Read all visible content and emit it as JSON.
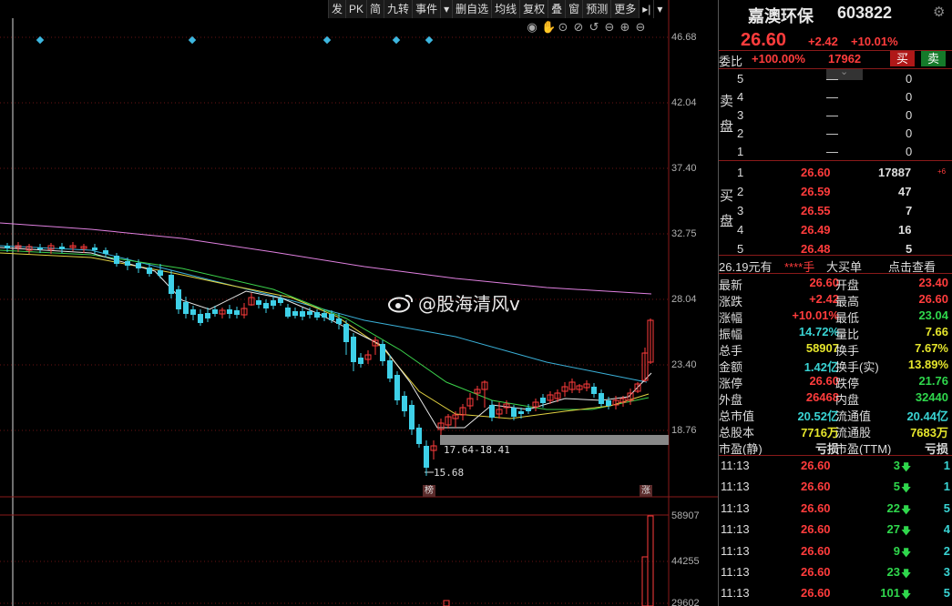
{
  "toolbar": {
    "items": [
      "发",
      "PK",
      "简",
      "九转",
      "事件",
      "▾",
      "删自选",
      "均线",
      "复权",
      "叠",
      "窗",
      "预测",
      "更多",
      "▸|",
      "▾"
    ]
  },
  "chart_tools": [
    "◉",
    "✋",
    "⊙",
    "⊘",
    "↺",
    "⊖",
    "⊕",
    "⊖"
  ],
  "price_axis": [
    "46.68",
    "42.04",
    "37.40",
    "32.75",
    "28.04",
    "23.40",
    "18.76"
  ],
  "volume_axis": [
    "58907",
    "44255",
    "29602"
  ],
  "markers": {
    "range_label": "17.64-18.41",
    "low_label": "15.68",
    "tag_bang": "榜",
    "tag_zhang": "涨"
  },
  "watermark": "@股海清风v",
  "stock": {
    "name": "嘉澳环保",
    "code": "603822",
    "price": "26.60",
    "change": "+2.42",
    "change_pct": "+10.01%"
  },
  "weibi": {
    "label": "委比",
    "value": "+100.00%",
    "diff": "17962",
    "sell_btn": "买",
    "buy_btn": "卖"
  },
  "sell_side": {
    "label": "卖盘",
    "rows": [
      {
        "level": "5",
        "price": "—",
        "volume": "0"
      },
      {
        "level": "4",
        "price": "—",
        "volume": "0"
      },
      {
        "level": "3",
        "price": "—",
        "volume": "0"
      },
      {
        "level": "2",
        "price": "—",
        "volume": "0"
      },
      {
        "level": "1",
        "price": "—",
        "volume": "0"
      }
    ]
  },
  "buy_side": {
    "label": "买盘",
    "rows": [
      {
        "level": "1",
        "price": "26.60",
        "volume": "17887",
        "extra": "+6"
      },
      {
        "level": "2",
        "price": "26.59",
        "volume": "47",
        "extra": ""
      },
      {
        "level": "3",
        "price": "26.55",
        "volume": "7",
        "extra": ""
      },
      {
        "level": "4",
        "price": "26.49",
        "volume": "16",
        "extra": ""
      },
      {
        "level": "5",
        "price": "26.48",
        "volume": "5",
        "extra": ""
      }
    ]
  },
  "big_order": {
    "amount": "26.19元有",
    "hand": "****手",
    "label": "大买单",
    "link": "点击查看"
  },
  "quote": [
    {
      "l1": "最新",
      "v1": "26.60",
      "l2": "开盘",
      "v2": "23.40"
    },
    {
      "l1": "涨跌",
      "v1": "+2.42",
      "l2": "最高",
      "v2": "26.60"
    },
    {
      "l1": "涨幅",
      "v1": "+10.01%",
      "l2": "最低",
      "v2": "23.04"
    },
    {
      "l1": "振幅",
      "v1": "14.72%",
      "l2": "量比",
      "v2": "7.66"
    },
    {
      "l1": "总手",
      "v1": "58907",
      "l2": "换手",
      "v2": "7.67%"
    },
    {
      "l1": "金额",
      "v1": "1.42亿",
      "l2": "换手(实)",
      "v2": "13.89%"
    },
    {
      "l1": "涨停",
      "v1": "26.60",
      "l2": "跌停",
      "v2": "21.76"
    },
    {
      "l1": "外盘",
      "v1": "26468",
      "l2": "内盘",
      "v2": "32440"
    },
    {
      "l1": "总市值",
      "v1": "20.52亿",
      "l2": "流通值",
      "v2": "20.44亿"
    },
    {
      "l1": "总股本",
      "v1": "7716万",
      "l2": "流通股",
      "v2": "7683万"
    },
    {
      "l1": "市盈(静)",
      "v1": "亏损",
      "l2": "市盈(TTM)",
      "v2": "亏损"
    }
  ],
  "trades": [
    {
      "time": "11:13",
      "price": "26.60",
      "vol": "3",
      "n": "1"
    },
    {
      "time": "11:13",
      "price": "26.60",
      "vol": "5",
      "n": "1"
    },
    {
      "time": "11:13",
      "price": "26.60",
      "vol": "22",
      "n": "5"
    },
    {
      "time": "11:13",
      "price": "26.60",
      "vol": "27",
      "n": "4"
    },
    {
      "time": "11:13",
      "price": "26.60",
      "vol": "9",
      "n": "2"
    },
    {
      "time": "11:13",
      "price": "26.60",
      "vol": "23",
      "n": "3"
    },
    {
      "time": "11:13",
      "price": "26.60",
      "vol": "101",
      "n": "5"
    }
  ]
}
